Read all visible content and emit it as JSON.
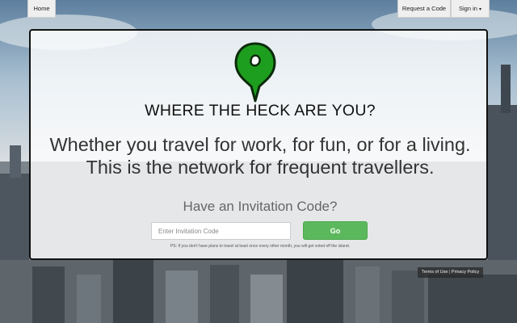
{
  "nav": {
    "home_label": "Home",
    "request_code_label": "Request a Code",
    "sign_in_label": "Sign in"
  },
  "hero": {
    "headline": "WHERE THE HECK ARE YOU?",
    "tagline": "Whether you travel for work, for fun, or for a living. This is the network for frequent travellers."
  },
  "invite": {
    "prompt": "Have an Invitation Code?",
    "input_placeholder": "Enter Invitation Code",
    "input_value": "",
    "go_label": "Go",
    "disclaimer": "PS: If you don't have plans to travel at least once every other month, you will get voted off the island."
  },
  "footer": {
    "terms_label": "Terms of Use",
    "separator": "|",
    "privacy_label": "Privacy Policy"
  },
  "icons": {
    "pin": "map-pin-icon",
    "caret": "caret-down-icon"
  },
  "colors": {
    "pin_green": "#1e9e1e",
    "go_green": "#5cb85c"
  }
}
